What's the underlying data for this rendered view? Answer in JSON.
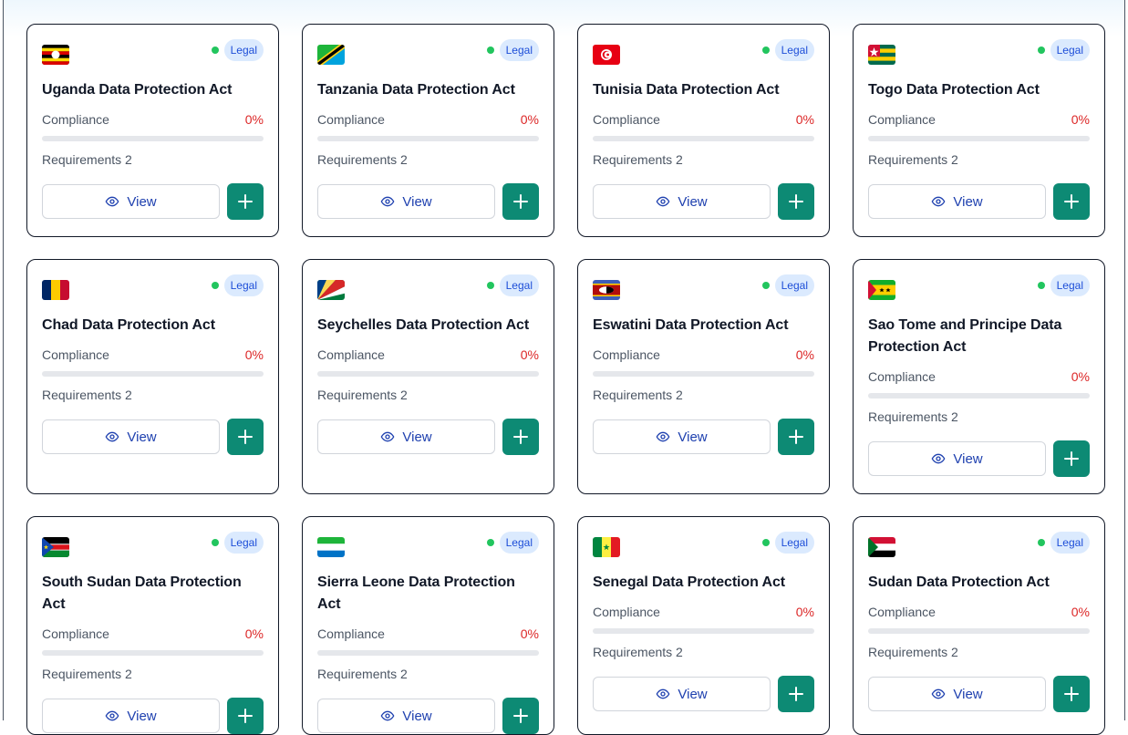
{
  "badge_label": "Legal",
  "compliance_label": "Compliance",
  "view_label": "View",
  "colors": {
    "accent": "#0d8a74",
    "badge_bg": "#dbeafe",
    "danger": "#dc2626",
    "status": "#22c55e"
  },
  "cards": [
    {
      "title": "Uganda Data Protection Act",
      "flag": "uganda-flag-icon",
      "compliance": "0%",
      "compliance_value": 0,
      "requirements": "Requirements 2"
    },
    {
      "title": "Tanzania Data Protection Act",
      "flag": "tanzania-flag-icon",
      "compliance": "0%",
      "compliance_value": 0,
      "requirements": "Requirements 2"
    },
    {
      "title": "Tunisia Data Protection Act",
      "flag": "tunisia-flag-icon",
      "compliance": "0%",
      "compliance_value": 0,
      "requirements": "Requirements 2"
    },
    {
      "title": "Togo Data Protection Act",
      "flag": "togo-flag-icon",
      "compliance": "0%",
      "compliance_value": 0,
      "requirements": "Requirements 2"
    },
    {
      "title": "Chad Data Protection Act",
      "flag": "chad-flag-icon",
      "compliance": "0%",
      "compliance_value": 0,
      "requirements": "Requirements 2"
    },
    {
      "title": "Seychelles Data Protection Act",
      "flag": "seychelles-flag-icon",
      "compliance": "0%",
      "compliance_value": 0,
      "requirements": "Requirements 2"
    },
    {
      "title": "Eswatini Data Protection Act",
      "flag": "eswatini-flag-icon",
      "compliance": "0%",
      "compliance_value": 0,
      "requirements": "Requirements 2"
    },
    {
      "title": "Sao Tome and Principe Data Protection Act",
      "flag": "sao-tome-flag-icon",
      "compliance": "0%",
      "compliance_value": 0,
      "requirements": "Requirements 2"
    },
    {
      "title": "South Sudan Data Protection Act",
      "flag": "south-sudan-flag-icon",
      "compliance": "0%",
      "compliance_value": 0,
      "requirements": "Requirements 2"
    },
    {
      "title": "Sierra Leone Data Protection Act",
      "flag": "sierra-leone-flag-icon",
      "compliance": "0%",
      "compliance_value": 0,
      "requirements": "Requirements 2"
    },
    {
      "title": "Senegal Data Protection Act",
      "flag": "senegal-flag-icon",
      "compliance": "0%",
      "compliance_value": 0,
      "requirements": "Requirements 2"
    },
    {
      "title": "Sudan Data Protection Act",
      "flag": "sudan-flag-icon",
      "compliance": "0%",
      "compliance_value": 0,
      "requirements": "Requirements 2"
    }
  ]
}
